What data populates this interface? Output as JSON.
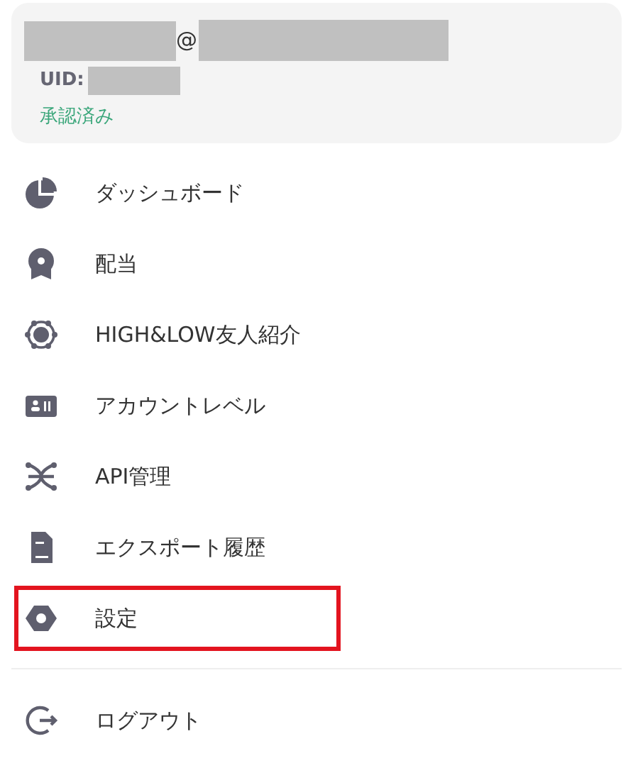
{
  "account": {
    "email_separator": "@",
    "uid_label": "UID:",
    "status": "承認済み"
  },
  "menu": [
    {
      "label": "ダッシュボード",
      "highlighted": false
    },
    {
      "label": "配当",
      "highlighted": false
    },
    {
      "label": "HIGH&LOW友人紹介",
      "highlighted": false
    },
    {
      "label": "アカウントレベル",
      "highlighted": false
    },
    {
      "label": "API管理",
      "highlighted": false
    },
    {
      "label": "エクスポート履歴",
      "highlighted": false
    },
    {
      "label": "設定",
      "highlighted": true
    }
  ],
  "logout": {
    "label": "ログアウト"
  }
}
